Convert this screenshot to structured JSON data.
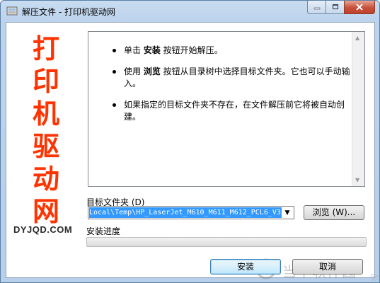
{
  "window": {
    "title": "解压文件 - 打印机驱动网"
  },
  "brand": {
    "chars": [
      "打",
      "印",
      "机",
      "驱",
      "动",
      "网"
    ],
    "site": "DYJQD.COM",
    "color": "#ff3300"
  },
  "instructions": [
    {
      "pre": "单击 ",
      "bold": "安装",
      "post": " 按钮开始解压。"
    },
    {
      "pre": "使用 ",
      "bold": "浏览",
      "post": " 按钮从目录树中选择目标文件夹。它也可以手动输入。"
    },
    {
      "pre": "",
      "bold": "",
      "post": "如果指定的目标文件夹不存在，在文件解压前它将被自动创建。"
    }
  ],
  "destination": {
    "label": "目标文件夹 (D)",
    "value": "Local\\Temp\\HP_LaserJet_M610_M611_M612_PCL6_V3"
  },
  "browse_label": "浏览 (W)...",
  "progress": {
    "label": "安装进度",
    "fraction": 0
  },
  "buttons": {
    "install": "安装",
    "cancel": "取消"
  },
  "watermark": {
    "text": "当下软件园"
  },
  "colors": {
    "accent": "#3399ff",
    "close_button": "#c7503b"
  }
}
